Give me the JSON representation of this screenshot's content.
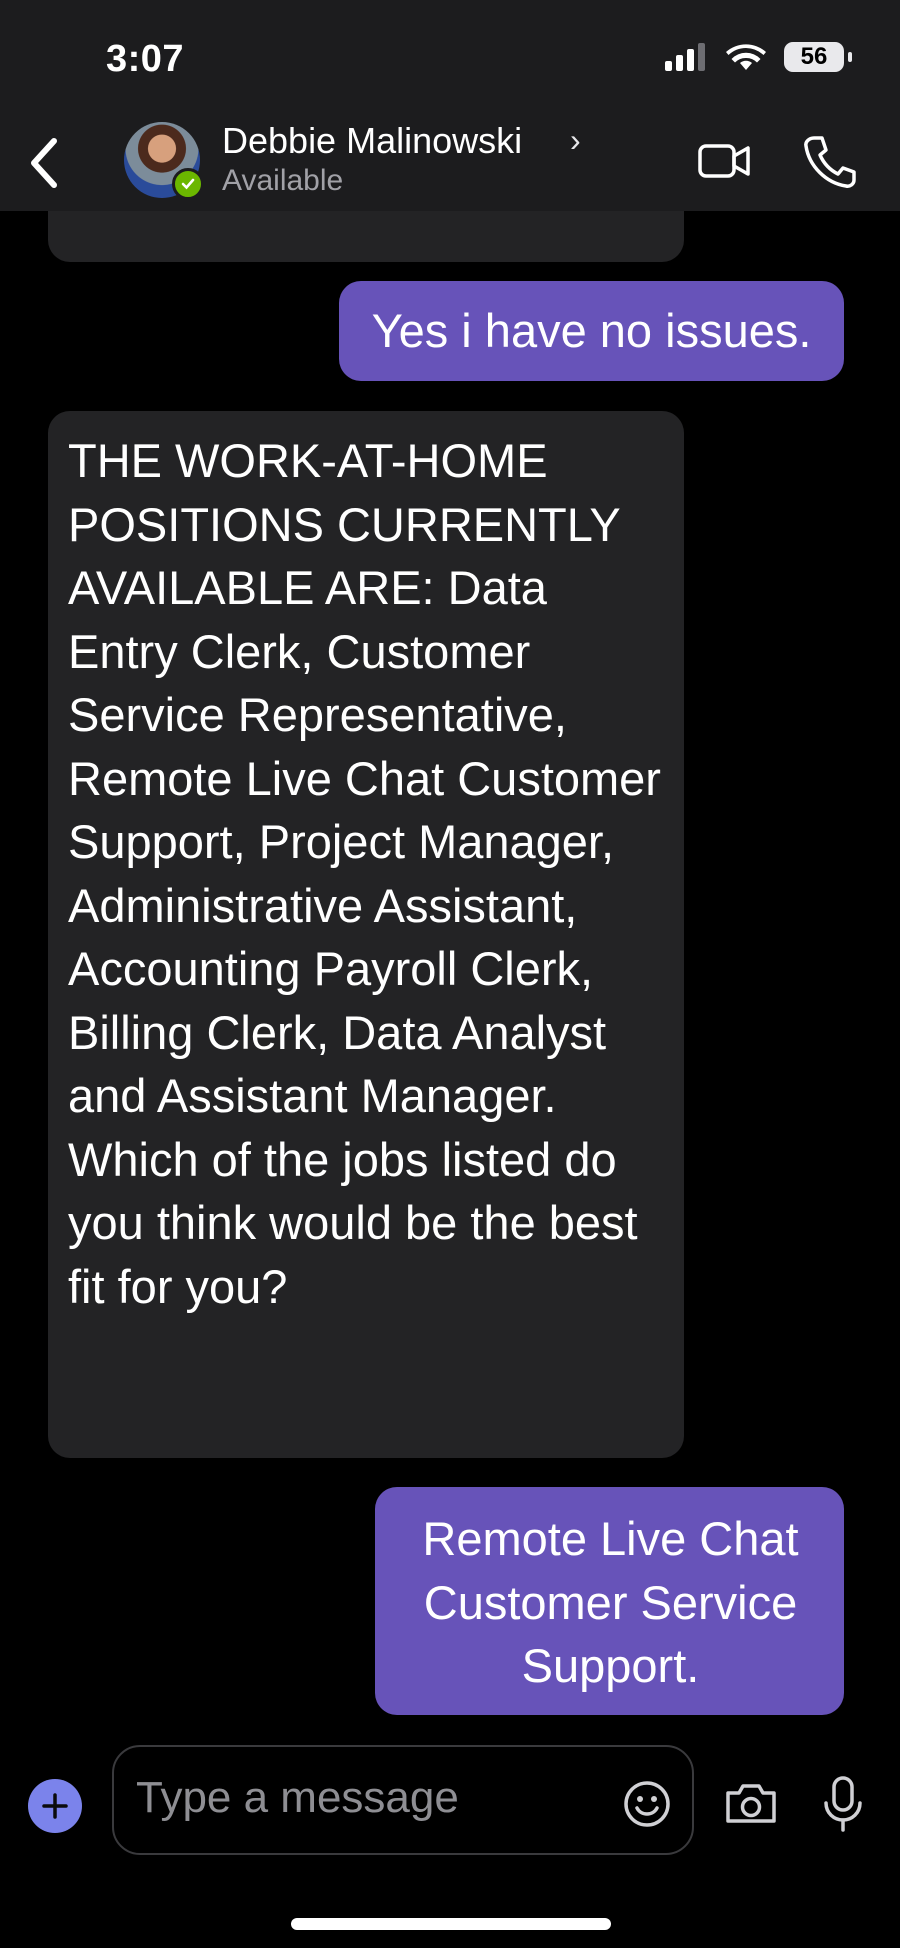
{
  "status_bar": {
    "time": "3:07",
    "battery": "56"
  },
  "header": {
    "contact_name": "Debbie Malinowski",
    "chevron": "›",
    "presence": "Available",
    "presence_color": "#6bb700"
  },
  "messages": [
    {
      "direction": "outgoing",
      "text": "Yes i have no issues."
    },
    {
      "direction": "incoming",
      "text": "THE WORK-AT-HOME POSITIONS CURRENTLY AVAILABLE ARE: Data Entry Clerk, Customer Service Representative, Remote Live Chat Customer Support, Project Manager, Administrative Assistant, Accounting Payroll Clerk, Billing Clerk, Data Analyst and Assistant Manager. Which of the jobs listed do you think would be the best fit for you?"
    },
    {
      "direction": "outgoing",
      "lines": [
        "Remote Live Chat",
        "Customer Service",
        "Support."
      ]
    }
  ],
  "composer": {
    "placeholder": "Type a message"
  },
  "colors": {
    "outgoing_bubble": "#6753b9",
    "incoming_bubble": "#232325",
    "accent": "#7b83eb"
  },
  "icons": [
    "back-arrow-icon",
    "video-call-icon",
    "phone-icon",
    "plus-icon",
    "emoji-icon",
    "camera-icon",
    "microphone-icon",
    "signal-icon",
    "wifi-icon",
    "battery-icon"
  ]
}
